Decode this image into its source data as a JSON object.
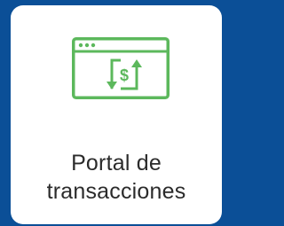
{
  "tile": {
    "title_lines": [
      "Portal de",
      "transacciones"
    ],
    "icon": "browser-dollar-exchange-icon",
    "accent_color": "#5cb85c",
    "text_color": "#2b2b2b",
    "card_color": "#ffffff",
    "background_color": "#0b4f97"
  }
}
